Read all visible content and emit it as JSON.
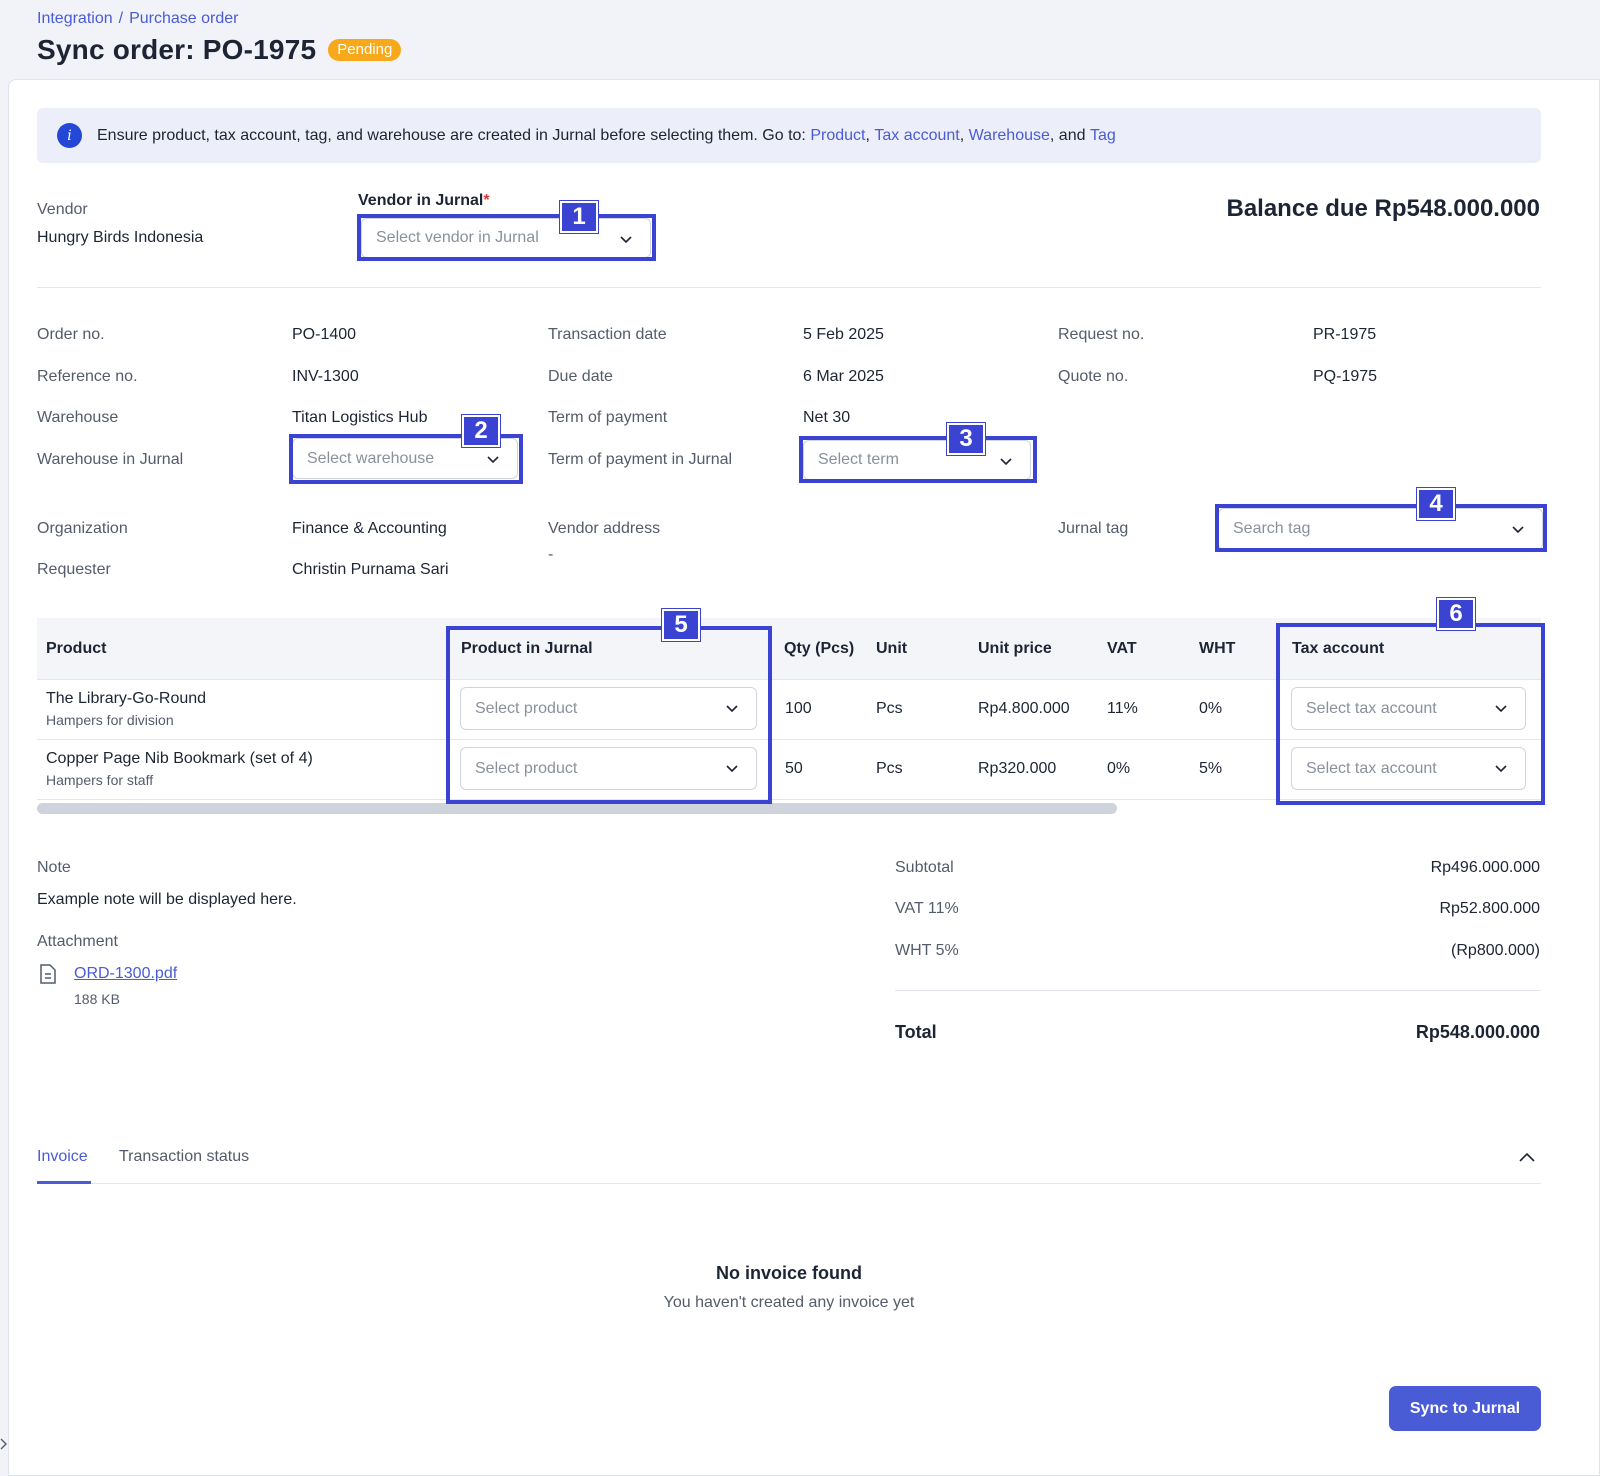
{
  "breadcrumb": {
    "parent": "Integration",
    "separator": "/",
    "current": "Purchase order"
  },
  "header": {
    "title": "Sync order: PO-1975",
    "status": "Pending"
  },
  "banner": {
    "text": "Ensure product, tax account, tag, and warehouse are created in Jurnal before selecting them. Go to:",
    "links": [
      "Product",
      "Tax account",
      "Warehouse",
      "Tag"
    ],
    "comma": ",",
    "and": "and"
  },
  "vendor": {
    "label": "Vendor",
    "value": "Hungry Birds Indonesia",
    "jurnal_label": "Vendor in Jurnal",
    "required": "*",
    "placeholder": "Select vendor in Jurnal"
  },
  "balance": "Balance due Rp548.000.000",
  "details": {
    "order_no_label": "Order no.",
    "order_no": "PO-1400",
    "reference_no_label": "Reference no.",
    "reference_no": "INV-1300",
    "warehouse_label": "Warehouse",
    "warehouse": "Titan Logistics Hub",
    "warehouse_jurnal_label": "Warehouse in Jurnal",
    "warehouse_placeholder": "Select warehouse",
    "transaction_date_label": "Transaction date",
    "transaction_date": "5 Feb 2025",
    "due_date_label": "Due date",
    "due_date": "6 Mar 2025",
    "term_label": "Term of payment",
    "term": "Net 30",
    "term_jurnal_label": "Term of payment in Jurnal",
    "term_placeholder": "Select term",
    "request_no_label": "Request no.",
    "request_no": "PR-1975",
    "quote_no_label": "Quote no.",
    "quote_no": "PQ-1975",
    "organization_label": "Organization",
    "organization": "Finance & Accounting",
    "requester_label": "Requester",
    "requester": "Christin Purnama Sari",
    "vendor_address_label": "Vendor address",
    "vendor_address": "-",
    "jurnal_tag_label": "Jurnal tag",
    "tag_placeholder": "Search tag"
  },
  "table": {
    "headers": [
      "Product",
      "Product in Jurnal",
      "Qty (Pcs)",
      "Unit",
      "Unit price",
      "VAT",
      "WHT",
      "Tax account"
    ],
    "rows": [
      {
        "product": "The Library-Go-Round",
        "sub": "Hampers for division",
        "product_placeholder": "Select product",
        "qty": "100",
        "unit": "Pcs",
        "price": "Rp4.800.000",
        "vat": "11%",
        "wht": "0%",
        "tax_placeholder": "Select tax account"
      },
      {
        "product": "Copper Page Nib Bookmark (set of 4)",
        "sub": "Hampers for staff",
        "product_placeholder": "Select product",
        "qty": "50",
        "unit": "Pcs",
        "price": "Rp320.000",
        "vat": "0%",
        "wht": "5%",
        "tax_placeholder": "Select tax account"
      }
    ]
  },
  "note": {
    "label": "Note",
    "text": "Example note will be displayed here."
  },
  "attachment": {
    "label": "Attachment",
    "file": "ORD-1300.pdf",
    "size": "188 KB"
  },
  "summary": {
    "subtotal_label": "Subtotal",
    "subtotal": "Rp496.000.000",
    "vat_label": "VAT 11%",
    "vat": "Rp52.800.000",
    "wht_label": "WHT 5%",
    "wht": "(Rp800.000)",
    "total_label": "Total",
    "total": "Rp548.000.000"
  },
  "tabs": [
    "Invoice",
    "Transaction status"
  ],
  "empty": {
    "title": "No invoice found",
    "subtitle": "You haven't created any invoice yet"
  },
  "sync_button": "Sync to Jurnal",
  "annotations": [
    "1",
    "2",
    "3",
    "4",
    "5",
    "6"
  ],
  "colors": {
    "accent": "#4a5bd6",
    "highlight": "#3a43d2",
    "badge": "#f7a81b"
  }
}
